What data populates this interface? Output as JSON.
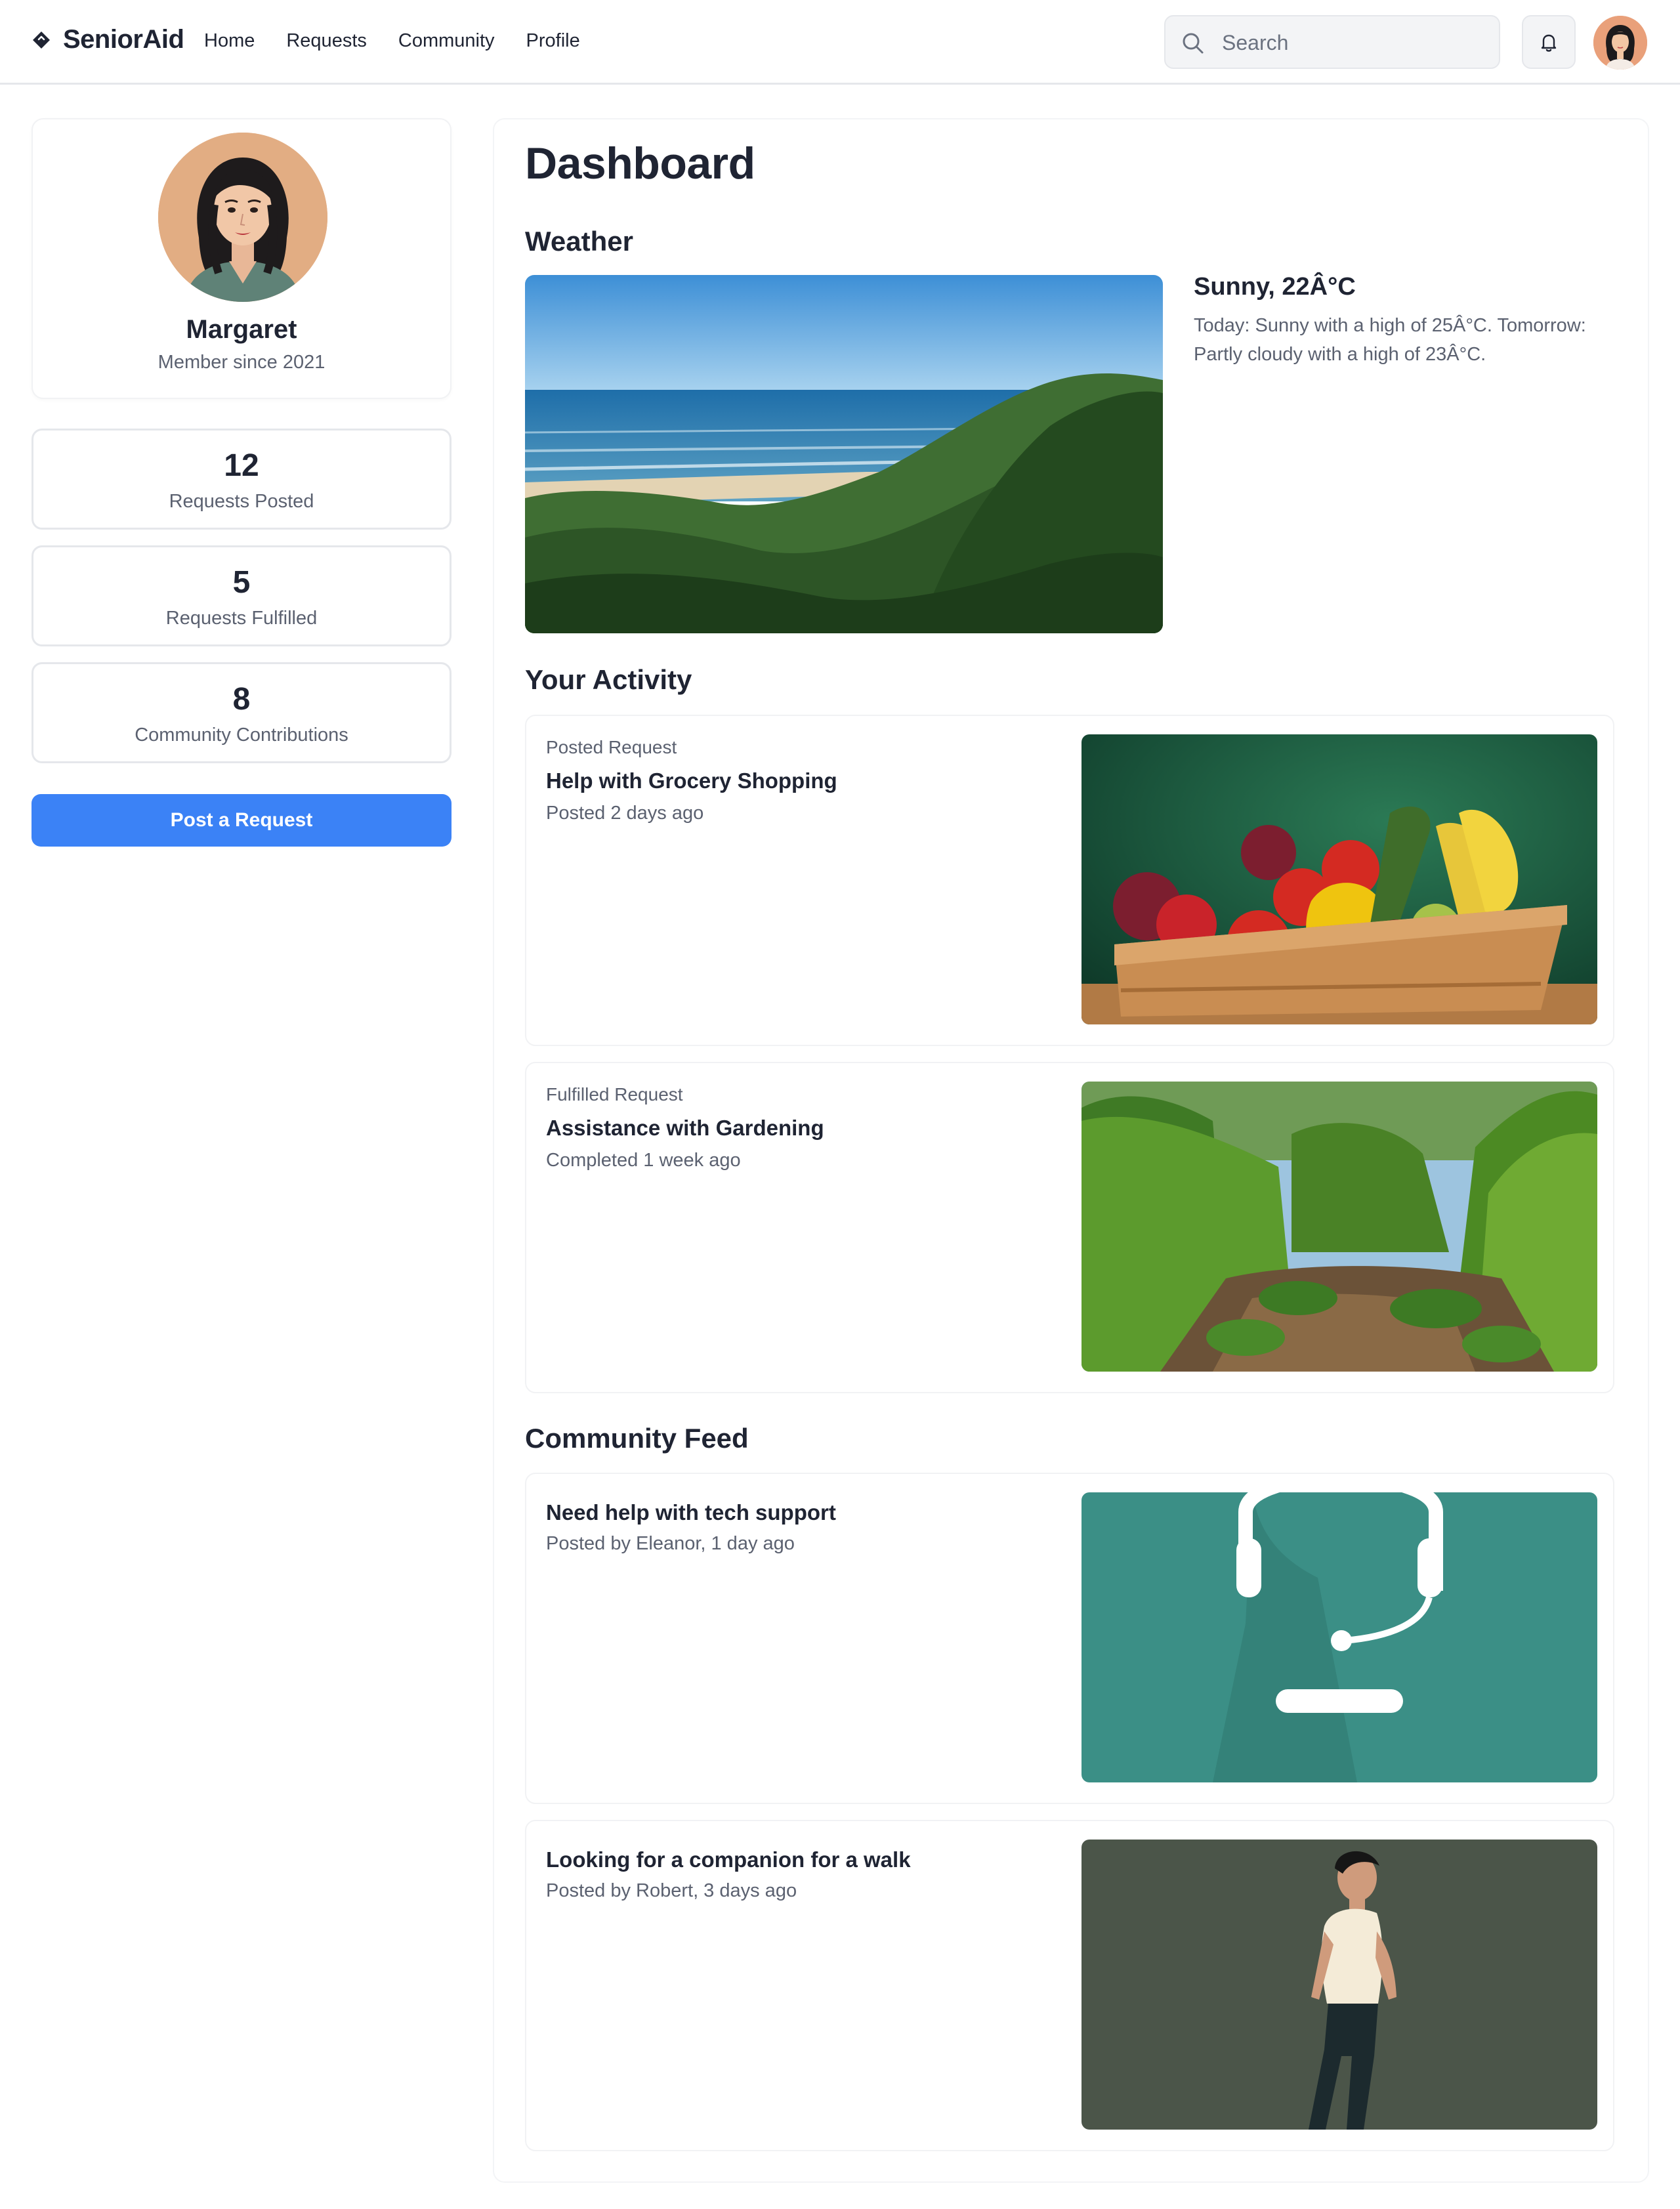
{
  "app": {
    "name": "SeniorAid",
    "logo_icon": "diamond-logo-icon"
  },
  "nav": {
    "items": [
      "Home",
      "Requests",
      "Community",
      "Profile"
    ]
  },
  "search": {
    "placeholder": "Search",
    "icon": "search-icon"
  },
  "header_icons": {
    "notifications": "bell-icon",
    "avatar": "user-avatar"
  },
  "profile": {
    "name": "Margaret",
    "member_since": "Member since 2021"
  },
  "stats": [
    {
      "value": "12",
      "label": "Requests Posted"
    },
    {
      "value": "5",
      "label": "Requests Fulfilled"
    },
    {
      "value": "8",
      "label": "Community Contributions"
    }
  ],
  "post_button": "Post a Request",
  "dashboard": {
    "title": "Dashboard"
  },
  "weather": {
    "heading": "Weather",
    "condition": "Sunny, 22Â°C",
    "description": "Today: Sunny with a high of 25Â°C. Tomorrow: Partly cloudy with a high of 23Â°C."
  },
  "activity": {
    "heading": "Your Activity",
    "items": [
      {
        "type": "Posted Request",
        "title": "Help with Grocery Shopping",
        "meta": "Posted 2 days ago"
      },
      {
        "type": "Fulfilled Request",
        "title": "Assistance with Gardening",
        "meta": "Completed 1 week ago"
      }
    ]
  },
  "feed": {
    "heading": "Community Feed",
    "items": [
      {
        "title": "Need help with tech support",
        "meta": "Posted by Eleanor, 1 day ago"
      },
      {
        "title": "Looking for a companion for a walk",
        "meta": "Posted by Robert, 3 days ago"
      }
    ]
  },
  "colors": {
    "accent": "#3b82f6",
    "text": "#1f2433",
    "muted": "#5b6170",
    "border": "#e5e7eb"
  }
}
